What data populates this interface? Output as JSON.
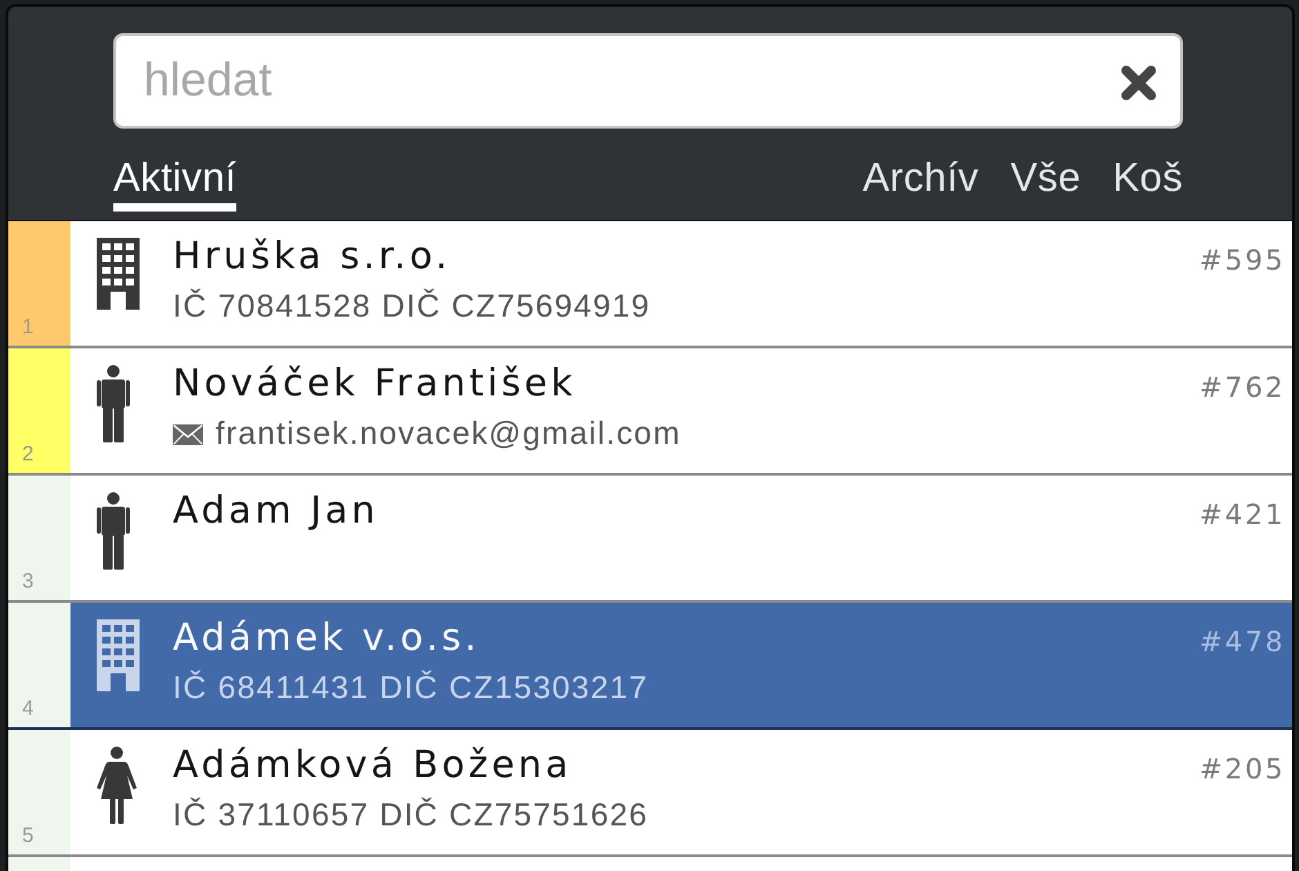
{
  "search": {
    "placeholder": "hledat"
  },
  "tabs": [
    {
      "label": "Aktivní",
      "selected": true
    },
    {
      "label": "Archív",
      "selected": false
    },
    {
      "label": "Vše",
      "selected": false
    },
    {
      "label": "Koš",
      "selected": false
    }
  ],
  "contacts": [
    {
      "line": "1",
      "kind": "company",
      "name": "Hruška s.r.o.",
      "detail": {
        "kind": "ids",
        "text": "IČ 70841528 DIČ CZ75694919"
      },
      "ref": "#595",
      "color": "#ffc86b",
      "selected": false
    },
    {
      "line": "2",
      "kind": "man",
      "name": "Nováček František",
      "detail": {
        "kind": "email",
        "text": "frantisek.novacek@gmail.com"
      },
      "ref": "#762",
      "color": "#ffff66",
      "selected": false
    },
    {
      "line": "3",
      "kind": "man",
      "name": "Adam Jan",
      "ref": "#421",
      "color": "#eef6ee",
      "selected": false
    },
    {
      "line": "4",
      "kind": "company",
      "name": "Adámek v.o.s.",
      "detail": {
        "kind": "ids",
        "text": "IČ 68411431 DIČ CZ15303217"
      },
      "ref": "#478",
      "color": "#eef6ee",
      "selected": true
    },
    {
      "line": "5",
      "kind": "woman",
      "name": "Adámková Božena",
      "detail": {
        "kind": "ids",
        "text": "IČ 37110657 DIČ CZ75751626"
      },
      "ref": "#205",
      "color": "#eef6ee",
      "selected": false
    }
  ]
}
